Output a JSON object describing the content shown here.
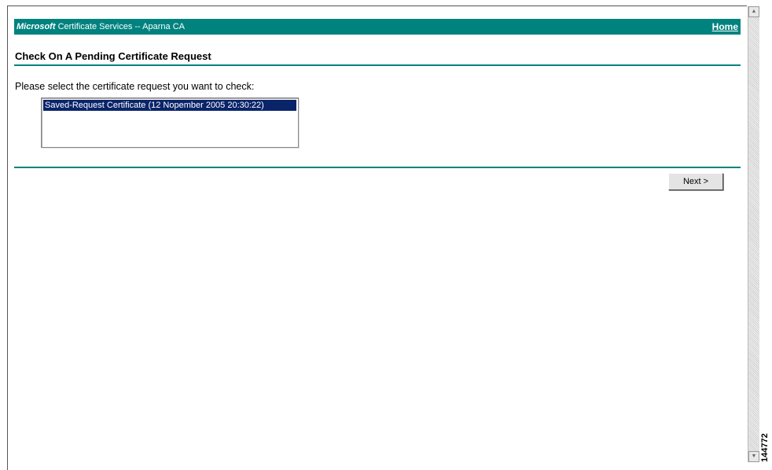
{
  "header": {
    "brand": "Microsoft",
    "service": "Certificate Services",
    "separator": "--",
    "ca_name": "Aparna CA",
    "home_link": "Home",
    "bar_color": "#00827f"
  },
  "page": {
    "title": "Check On A Pending Certificate Request",
    "prompt": "Please select the certificate request you want to check:"
  },
  "request_list": {
    "options": [
      "Saved-Request Certificate (12 Nopember 2005 20:30:22)"
    ],
    "selected_index": 0,
    "selection_color": "#0a246a"
  },
  "buttons": {
    "next_label": "Next >"
  },
  "figure": {
    "id": "144772"
  }
}
